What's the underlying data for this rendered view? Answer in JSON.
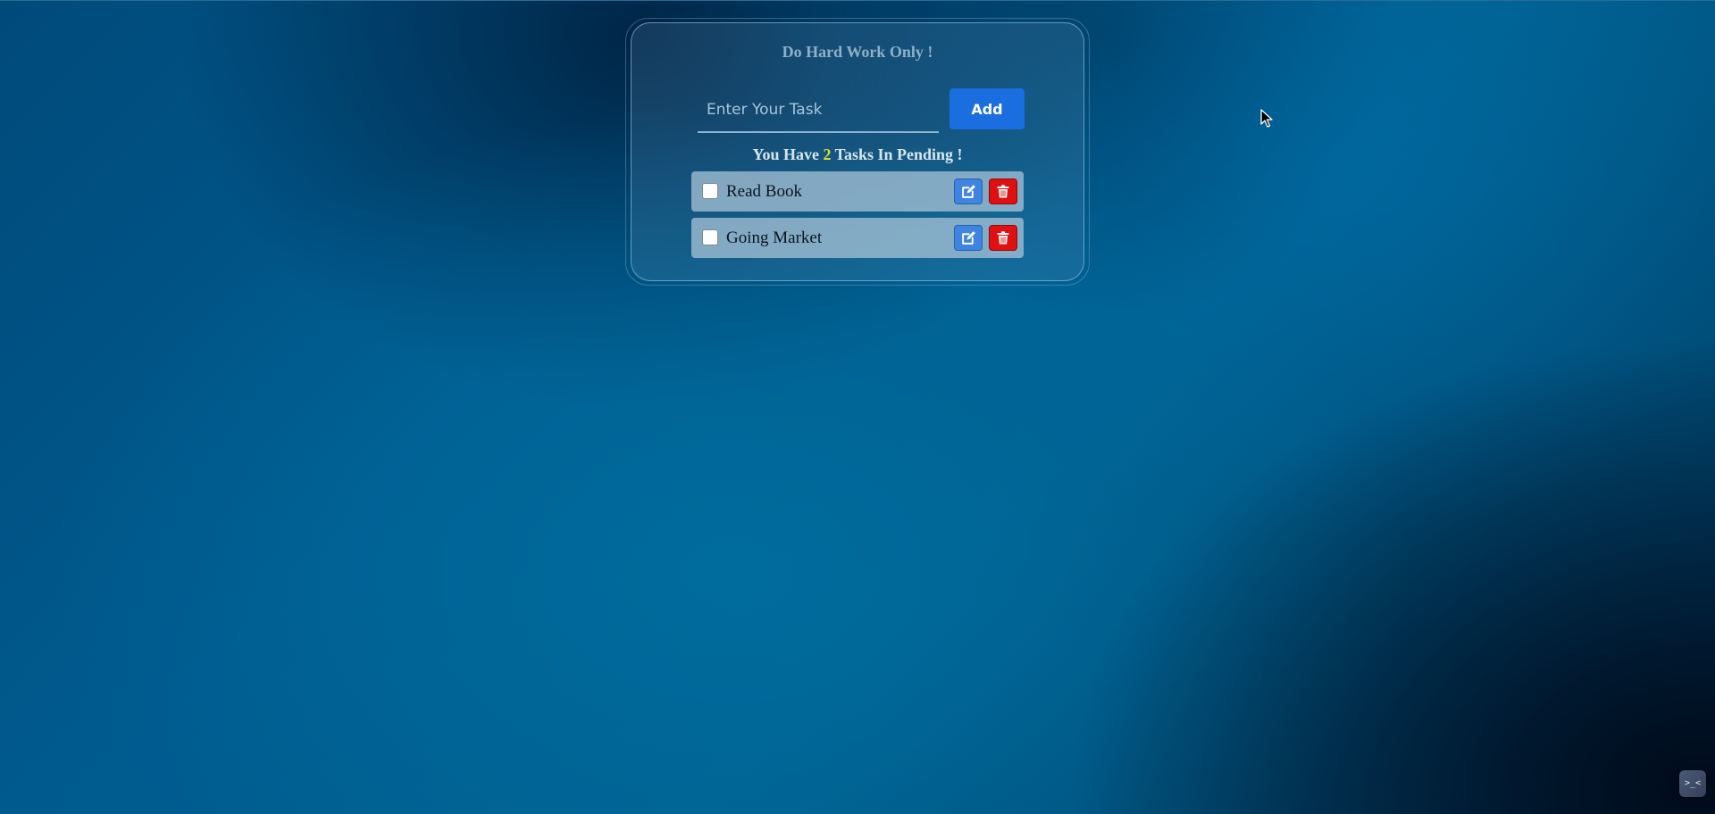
{
  "app": {
    "title": "Do Hard Work Only !"
  },
  "input": {
    "placeholder": "Enter Your Task",
    "value": "",
    "add_label": "Add"
  },
  "pending": {
    "prefix": "You Have",
    "count": "2",
    "suffix": "Tasks In Pending !"
  },
  "tasks": [
    {
      "label": "Read Book",
      "checked": false
    },
    {
      "label": "Going Market",
      "checked": false
    }
  ],
  "icons": {
    "edit": "edit-icon",
    "delete": "trash-icon",
    "corner_widget": "terminal-icon",
    "cursor": "mouse-pointer-icon"
  },
  "colors": {
    "add_button": "#1a6ee0",
    "edit_button": "#3e84e0",
    "delete_button": "#e01010",
    "pending_count": "#d9dc32"
  }
}
